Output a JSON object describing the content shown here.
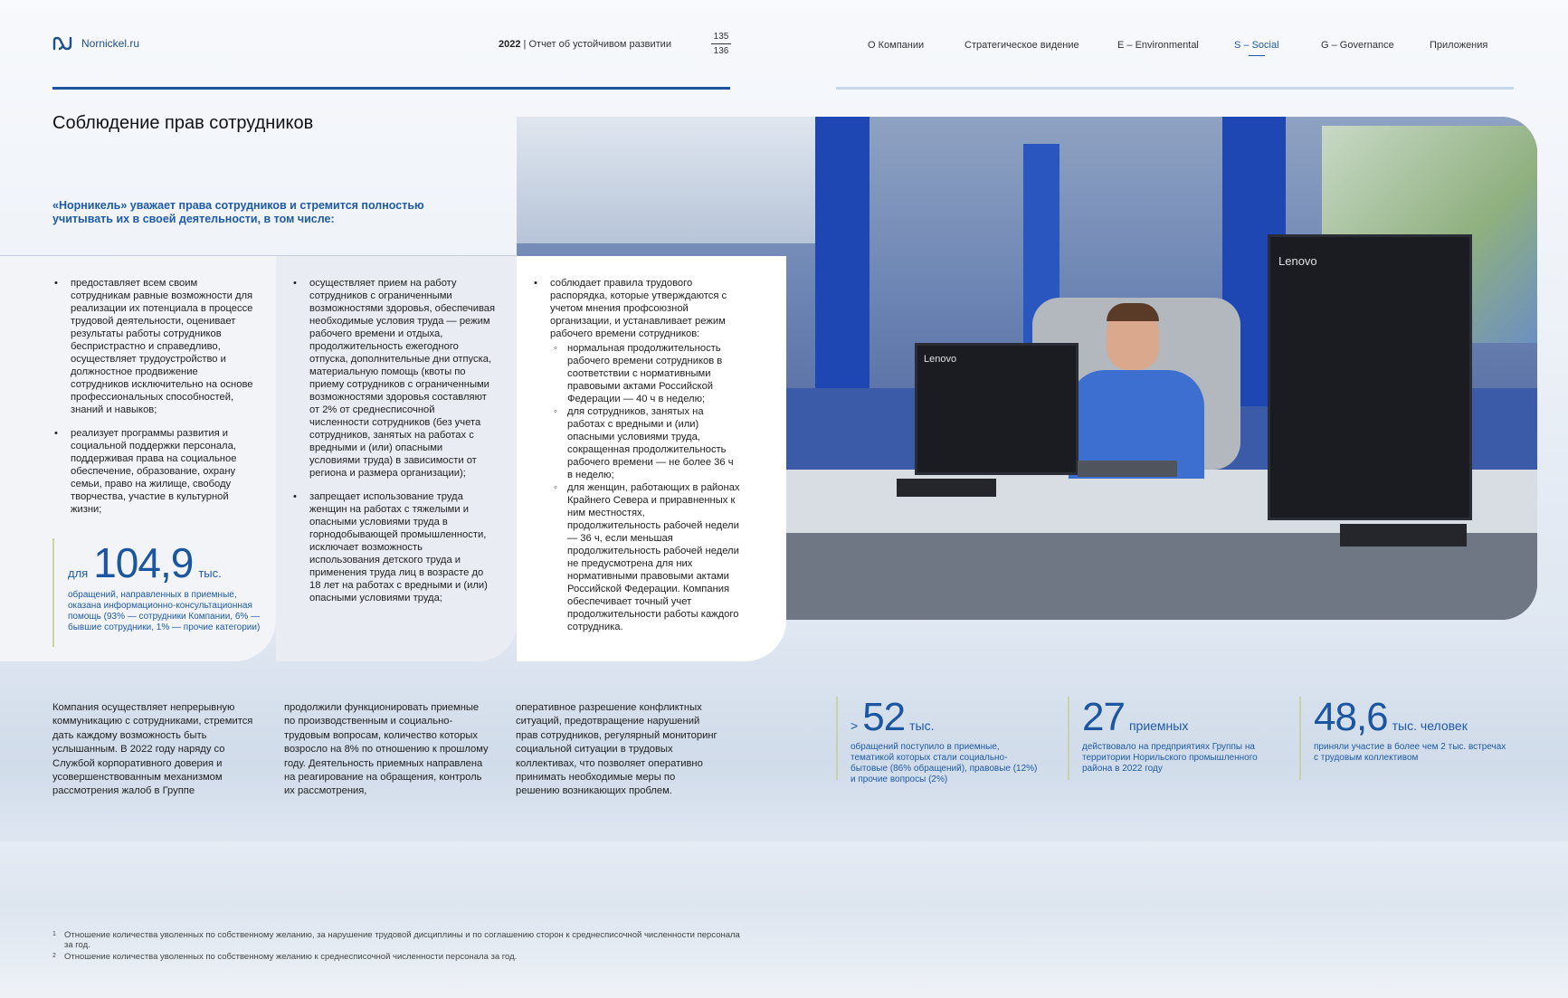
{
  "header": {
    "site": "Nornickel.ru",
    "report_year": "2022",
    "report_title": "Отчет об устойчивом развитии",
    "page_current": "135",
    "page_total": "136",
    "nav": [
      "О Компании",
      "Стратегическое видение",
      "E – Environmental",
      "S – Social",
      "G – Governance",
      "Приложения"
    ],
    "nav_active": "S – Social"
  },
  "title": "Соблюдение прав сотрудников",
  "lead": "«Норникель» уважает права сотрудников и стремится полностью учитывать их в своей деятельности, в том числе:",
  "col1": {
    "items": [
      "предоставляет всем своим сотрудникам равные возможности для реализации их потенциала в процессе трудовой деятельности, оценивает результаты работы сотрудников беспристрастно и справедливо, осуществляет трудоустройство и должностное продвижение сотрудников исключительно на основе профессиональных способностей, знаний и навыков;",
      "реализует программы развития и социальной поддержки персонала, поддерживая права на социальное обеспечение, образование, охрану семьи, право на жилище, свободу творчества, участие в культурной жизни;"
    ]
  },
  "col2": {
    "items": [
      "осуществляет прием на работу сотрудников с ограниченными возможностями здоровья, обеспечивая необходимые условия труда — режим рабочего времени и отдыха, продолжительность ежегодного отпуска, дополнительные дни отпуска, материальную помощь (квоты по приему сотрудников с ограниченными возможностями здоровья составляют от 2% от среднесписочной численности сотрудников (без учета сотрудников, занятых на работах с вредными и (или) опасными условиями труда) в зависимости от региона и размера организации);",
      "запрещает использование труда женщин на работах с тяжелыми и опасными условиями труда в горнодобывающей промышленности, исключает возможность использования детского труда и применения труда лиц в возрасте до 18 лет на работах с вредными и (или) опасными условиями труда;"
    ]
  },
  "col3": {
    "item": "соблюдает правила трудового распорядка, которые утверждаются с учетом мнения профсоюзной организации, и устанавливает режим рабочего времени сотрудников:",
    "sub": [
      "нормальная продолжительность рабочего времени сотрудников в соответствии с нормативными правовыми актами Российской Федерации — 40 ч в неделю;",
      "для сотрудников, занятых на работах с вредными и (или) опасными условиями труда, сокращенная продолжительность рабочего времени — не более 36 ч в неделю;",
      "для женщин, работающих в районах Крайнего Севера и приравненных к ним местностях, продолжительность рабочей недели — 36 ч, если меньшая продолжительность рабочей недели не предусмотрена для них нормативными правовыми актами Российской Федерации. Компания обеспечивает точный учет продолжительности работы каждого сотрудника."
    ]
  },
  "stat_main": {
    "prefix": "для",
    "value": "104,9",
    "unit": "тыс.",
    "desc": "обращений, направленных в приемные, оказана информационно-консультационная помощь (93% — сотрудники Компании, 6% — бывшие сотрудники, 1% — прочие категории)"
  },
  "bottom_text": [
    "Компания осуществляет непрерывную коммуникацию с сотрудниками, стремится дать каждому возможность быть услышанным. В 2022 году наряду со Службой корпоративного доверия и усовершенствованным механизмом рассмотрения жалоб в Группе",
    "продолжили функционировать приемные по производственным и социально-трудовым вопросам, количество которых возросло на 8% по отношению к прошлому году. Деятельность приемных направлена на реагирование на обращения, контроль их рассмотрения,",
    "оперативное разрешение конфликтных ситуаций, предотвращение нарушений прав сотрудников, регулярный мониторинг социальной ситуации в трудовых коллективах, что позволяет оперативно принимать необходимые меры по решению возникающих проблем."
  ],
  "stats": [
    {
      "prefix": ">",
      "value": "52",
      "unit": "тыс.",
      "desc": "обращений поступило в приемные, тематикой которых стали социально-бытовые (86% обращений), правовые (12%) и прочие вопросы (2%)"
    },
    {
      "prefix": "",
      "value": "27",
      "unit": "приемных",
      "desc": "действовало на предприятиях Группы на территории Норильского промышленного района в 2022 году"
    },
    {
      "prefix": "",
      "value": "48,6",
      "unit": "тыс. человек",
      "desc": "приняли участие в более чем 2 тыс. встречах с трудовым коллективом"
    }
  ],
  "footnotes": [
    {
      "mark": "1",
      "text": "Отношение количества уволенных по собственному желанию, за нарушение трудовой дисциплины и по соглашению сторон к среднесписочной численности персонала за год."
    },
    {
      "mark": "2",
      "text": "Отношение количества уволенных по собственному желанию к среднесписочной численности персонала за год."
    }
  ],
  "photo": {
    "brand1": "Lenovo",
    "brand2": "Lenovo"
  },
  "colors": {
    "accent": "#1c55a0",
    "accent_text": "#1e5aa8",
    "divider": "#c9d2a7"
  }
}
